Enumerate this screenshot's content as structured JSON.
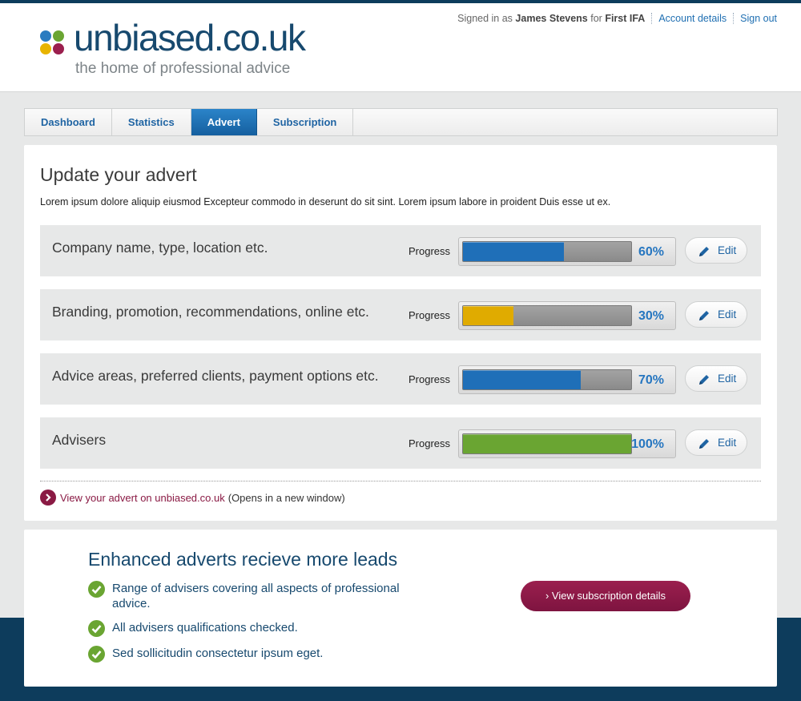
{
  "header": {
    "logo_text": "unbiased.co.uk",
    "tagline": "the home of professional advice",
    "account": {
      "signed_in_prefix": "Signed in as",
      "user_name": "James Stevens",
      "for_text": "for",
      "firm": "First IFA",
      "account_details": "Account details",
      "sign_out": "Sign out"
    },
    "logo_colors": [
      "#2a7cc0",
      "#6aa532",
      "#e8b400",
      "#9b1f4e"
    ]
  },
  "tabs": [
    {
      "label": "Dashboard",
      "active": false
    },
    {
      "label": "Statistics",
      "active": false
    },
    {
      "label": "Advert",
      "active": true
    },
    {
      "label": "Subscription",
      "active": false
    }
  ],
  "main": {
    "title": "Update your advert",
    "intro": "Lorem ipsum dolore aliquip eiusmod Excepteur commodo in deserunt do sit sint. Lorem ipsum labore in proident Duis esse ut ex.",
    "progress_label": "Progress",
    "edit_label": "Edit",
    "sections": [
      {
        "title": "Company name, type, location etc.",
        "percent": 60,
        "percent_label": "60%",
        "color": "#1f6fb8"
      },
      {
        "title": "Branding, promotion, recommendations, online etc.",
        "percent": 30,
        "percent_label": "30%",
        "color": "#e0ab00"
      },
      {
        "title": "Advice areas, preferred clients, payment options etc.",
        "percent": 70,
        "percent_label": "70%",
        "color": "#1f6fb8"
      },
      {
        "title": "Advisers",
        "percent": 100,
        "percent_label": "100%",
        "color": "#6aa532"
      }
    ],
    "view_link": "View your advert on unbiased.co.uk",
    "view_note": "(Opens in a new window)"
  },
  "promo": {
    "title": "Enhanced adverts recieve more leads",
    "features": [
      "Range of advisers covering all aspects of professional advice.",
      "All advisers qualifications checked.",
      "Sed sollicitudin consectetur ipsum eget."
    ],
    "button": "View subscription details"
  }
}
